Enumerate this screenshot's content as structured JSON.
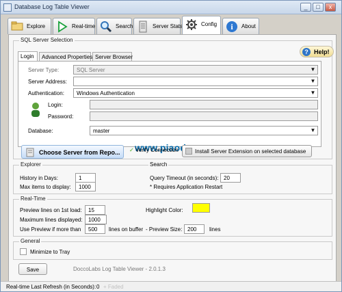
{
  "window": {
    "title": "Database Log Table Viewer",
    "minimize": "_",
    "maximize": "□",
    "close": "x"
  },
  "tabs": [
    {
      "label": "Explore",
      "icon": "explore-icon"
    },
    {
      "label": "Real-time",
      "icon": "realtime-icon"
    },
    {
      "label": "Search",
      "icon": "search-icon"
    },
    {
      "label": "Server Stats",
      "icon": "server-stats-icon"
    },
    {
      "label": "Config",
      "icon": "gear-icon"
    },
    {
      "label": "About",
      "icon": "about-icon"
    }
  ],
  "sqlserver": {
    "section_title": "SQL Server Selection",
    "subtabs": [
      "Login",
      "Advanced Properties",
      "Server Browser"
    ],
    "help": "Help!",
    "fields": {
      "server_type_label": "Server Type:",
      "server_type_value": "SQL Server",
      "server_address_label": "Server Address:",
      "server_address_value": "",
      "authentication_label": "Authentication:",
      "authentication_value": "Windows Authentication",
      "login_label": "Login:",
      "login_value": "",
      "password_label": "Password:",
      "password_value": "",
      "database_label": "Database:",
      "database_value": "master"
    },
    "choose_server": "Choose Server from Repo...",
    "verify_connection": "Verify Connection",
    "install_extension": "Install Server Extension on selected database"
  },
  "watermark": "www.piaodown.com",
  "explorer": {
    "title": "Explorer",
    "history_label": "History in Days:",
    "history_value": "1",
    "max_items_label": "Max items to display:",
    "max_items_value": "1000"
  },
  "search": {
    "title": "Search",
    "timeout_label": "Query Timeout (in seconds):",
    "timeout_value": "20",
    "note": "* Requires Application Restart"
  },
  "realtime": {
    "title": "Real-Time",
    "preview_lines_label": "Preview lines on 1st load:",
    "preview_lines_value": "15",
    "max_lines_label": "Maximum lines displayed:",
    "max_lines_value": "1000",
    "use_preview_label": "Use Preview if more than",
    "use_preview_value": "500",
    "lines_on_buffer": "lines on buffer",
    "preview_size_label": "- Preview Size:",
    "preview_size_value": "200",
    "lines": "lines",
    "highlight_label": "Highlight Color:",
    "highlight_color": "#ffff00"
  },
  "general": {
    "title": "General",
    "minimize_tray": "Minimize to Tray"
  },
  "footer": {
    "save": "Save",
    "version": "DoccoLabs Log Table Viewer - 2.0.1.3"
  },
  "status": {
    "refresh_label": "Real-time Last Refresh (in Seconds):",
    "refresh_value": "0",
    "faded": "+ Faded"
  }
}
